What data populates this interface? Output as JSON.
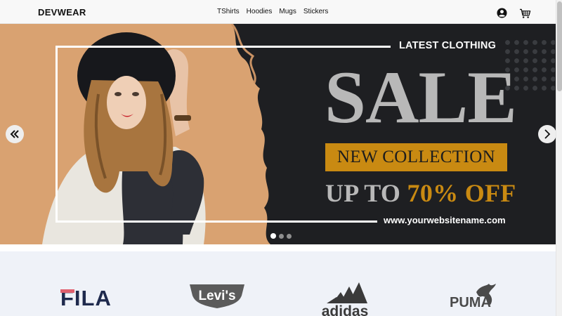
{
  "navbar": {
    "brand": "DEVWEAR",
    "links": [
      "TShirts",
      "Hoodies",
      "Mugs",
      "Stickers"
    ],
    "icons": {
      "account": "account-circle-icon",
      "cart": "cart-icon"
    }
  },
  "hero": {
    "slide": {
      "tagline": "LATEST CLOTHING",
      "headline": "SALE",
      "banner": "NEW COLLECTION",
      "offer_prefix": "UP TO ",
      "offer_value": "70% OFF",
      "website": "www.yourwebsitename.com"
    },
    "controls": {
      "prev_icon": "chevrons-left-icon",
      "next_icon": "chevron-right-icon"
    },
    "indicators": {
      "count": 3,
      "active": 1
    }
  },
  "brands": [
    "FILA",
    "Levi's",
    "adidas",
    "PUMA"
  ],
  "colors": {
    "hero_bg": "#1e1f22",
    "accent": "#c98a12",
    "sale_gray": "#b8b8b8",
    "brands_bg": "#eff2f8"
  }
}
